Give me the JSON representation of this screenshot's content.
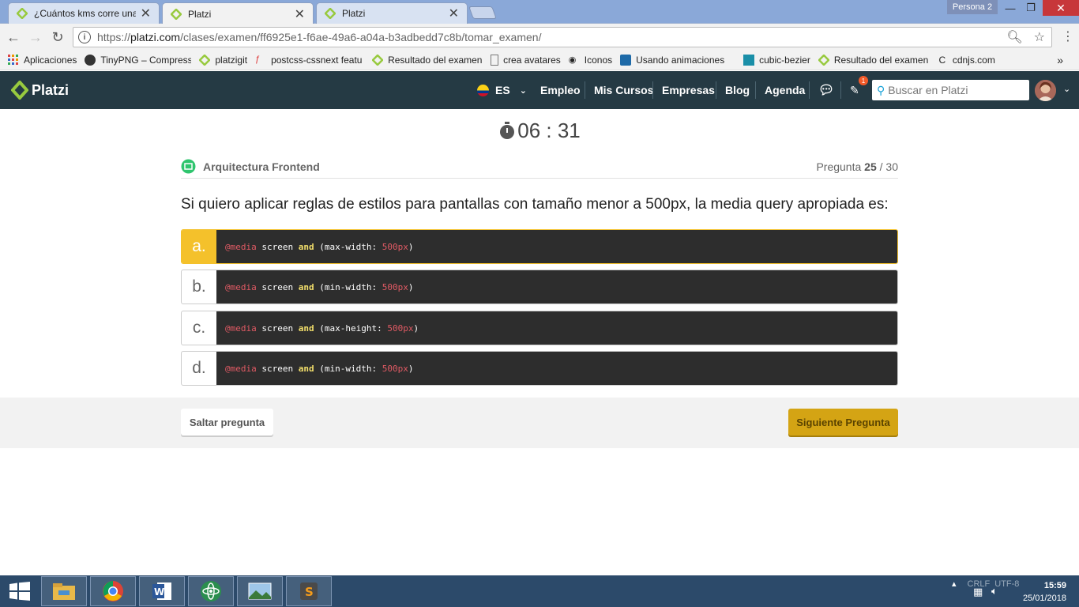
{
  "browser": {
    "tabs": [
      {
        "title": "¿Cuántos kms corre una (",
        "active": false
      },
      {
        "title": "Platzi",
        "active": true
      },
      {
        "title": "Platzi",
        "active": false
      }
    ],
    "profile": "Persona 2",
    "url_prefix": "https://",
    "url_host": "platzi.com",
    "url_path": "/clases/examen/ff6925e1-f6ae-49a6-a04a-b3adbedd7c8b/tomar_examen/",
    "bookmarks": [
      "Aplicaciones",
      "TinyPNG – Compress",
      "platzigit",
      "postcss-cssnext featu",
      "Resultado del examen",
      "crea avatares",
      "Iconos",
      "Usando animaciones",
      "cubic-bezier",
      "Resultado del examen",
      "cdnjs.com"
    ],
    "more": "»"
  },
  "site": {
    "logo": "Platzi",
    "lang": "ES",
    "nav": [
      "Empleo",
      "Mis Cursos",
      "Empresas",
      "Blog",
      "Agenda"
    ],
    "notifications": "1",
    "search_placeholder": "Buscar en Platzi"
  },
  "exam": {
    "timer": "06 : 31",
    "course": "Arquitectura Frontend",
    "progress_label": "Pregunta",
    "current": "25",
    "total": "/ 30",
    "question": "Si quiero aplicar reglas de estilos para pantallas con tamaño menor a 500px, la media query apropiada es:",
    "options": [
      {
        "letter": "a.",
        "at": "@media",
        "mid": " screen ",
        "and": "and",
        "prop": " (max-width: ",
        "num": "500px",
        "close": ")",
        "selected": true
      },
      {
        "letter": "b.",
        "at": "@media",
        "mid": " screen ",
        "and": "and",
        "prop": " (min-width: ",
        "num": "500px",
        "close": ")",
        "selected": false
      },
      {
        "letter": "c.",
        "at": "@media",
        "mid": " screen ",
        "and": "and",
        "prop": " (max-height: ",
        "num": "500px",
        "close": ")",
        "selected": false
      },
      {
        "letter": "d.",
        "at": "@media",
        "mid": " screen ",
        "and": "and",
        "prop": " (min-width: ",
        "num": "500px",
        "close": ")",
        "selected": false
      }
    ],
    "skip_label": "Saltar pregunta",
    "next_label": "Siguiente Pregunta"
  },
  "taskbar": {
    "time": "15:59",
    "date": "25/01/2018",
    "tray_text": [
      "CRLF",
      "UTF-8"
    ]
  },
  "colors": {
    "nav_bg": "#253a44",
    "accent_yellow": "#f4c12b",
    "next_button": "#d4a414",
    "code_bg": "#2d2d2d",
    "platzi_green": "#98ca3f"
  }
}
